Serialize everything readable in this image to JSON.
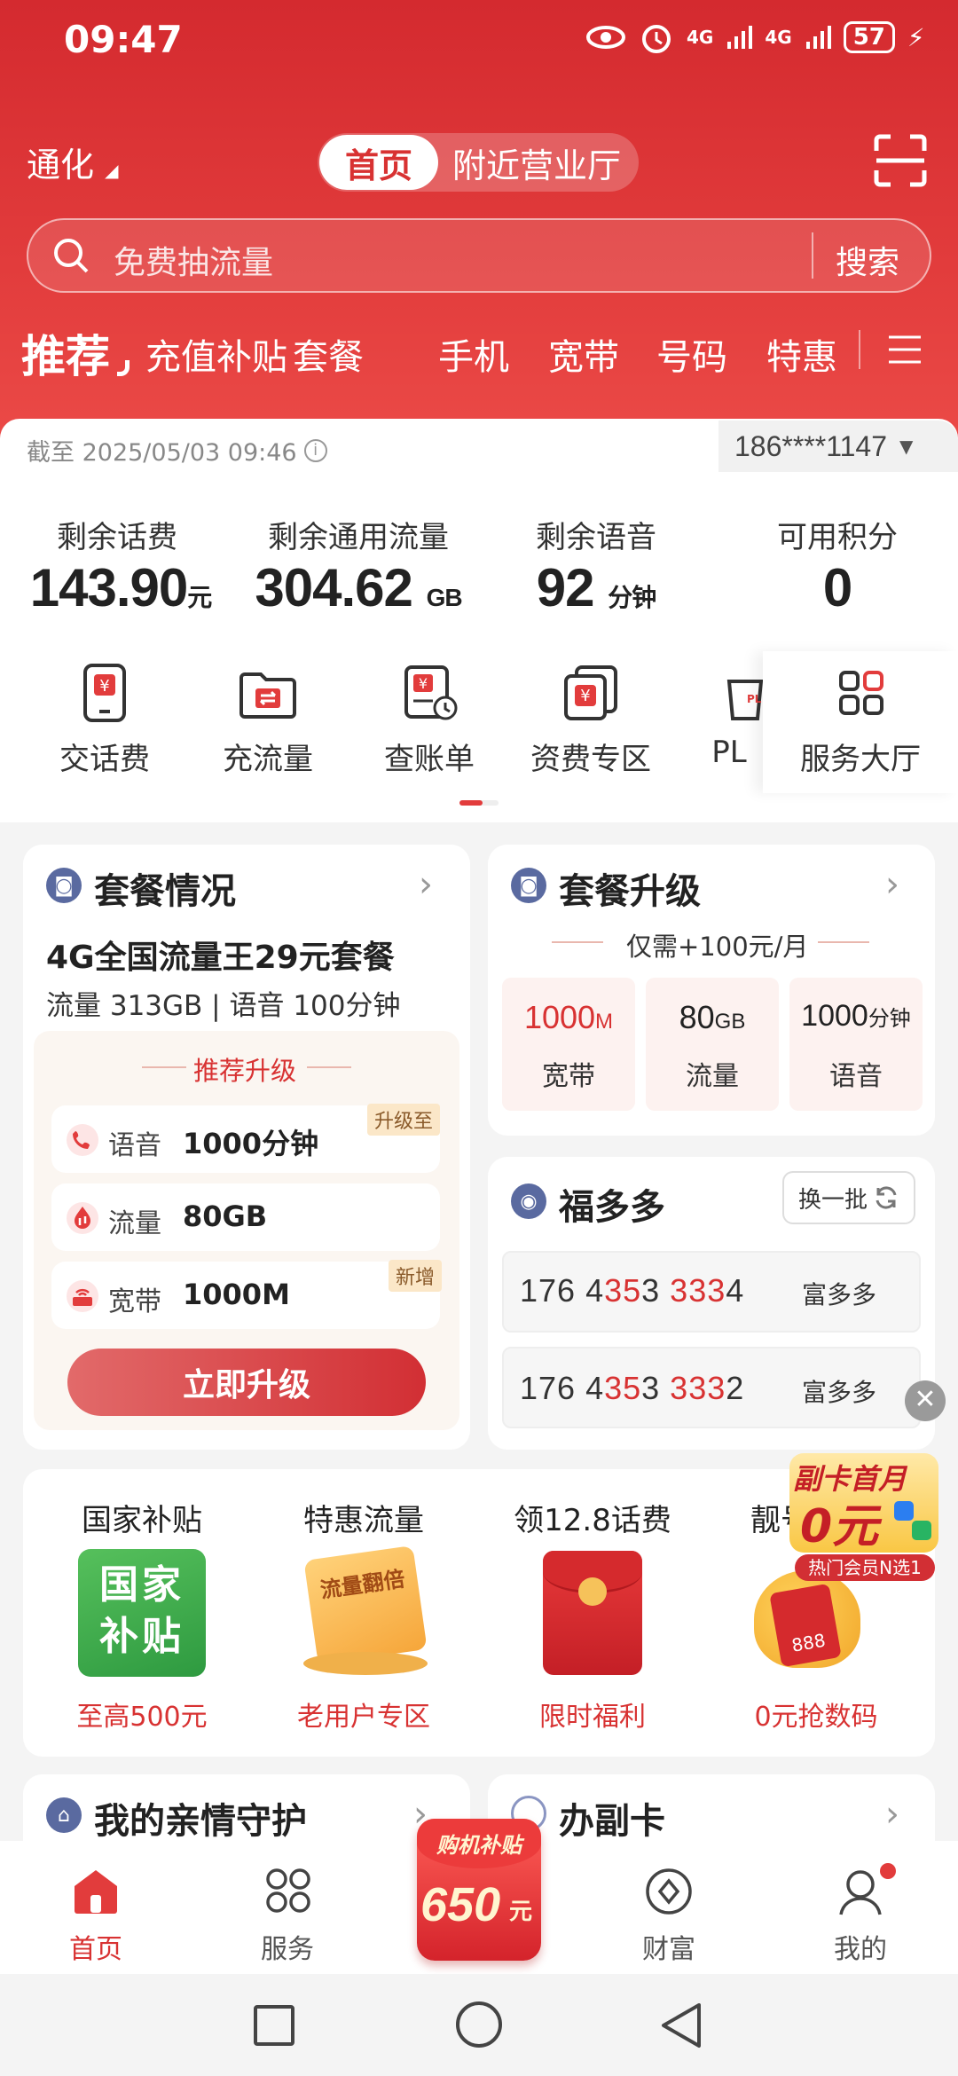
{
  "status_bar": {
    "time": "09:47",
    "battery": "57",
    "net1": "4G",
    "net2": "4G"
  },
  "header": {
    "city": "通化",
    "tabs": [
      "首页",
      "附近营业厅"
    ],
    "search": {
      "placeholder": "免费抽流量",
      "button": "搜索"
    },
    "categories": [
      "推荐",
      "充值补贴",
      "套餐",
      "手机",
      "宽带",
      "号码",
      "特惠"
    ]
  },
  "account": {
    "timestamp": "截至 2025/05/03 09:46",
    "phone": "186****1147",
    "stats": [
      {
        "label": "剩余话费",
        "value": "143.90",
        "unit": "元"
      },
      {
        "label": "剩余通用流量",
        "value": "304.62",
        "unit": "GB"
      },
      {
        "label": "剩余语音",
        "value": "92",
        "unit": "分钟"
      },
      {
        "label": "可用积分",
        "value": "0",
        "unit": ""
      }
    ],
    "services": [
      "交话费",
      "充流量",
      "查账单",
      "资费专区",
      "PL",
      "服务大厅"
    ]
  },
  "plan": {
    "title": "套餐情况",
    "name": "4G全国流量王29元套餐",
    "detail": "流量 313GB | 语音 100分钟",
    "upgrade_title": "推荐升级",
    "rows": [
      {
        "label": "语音",
        "value": "1000分钟",
        "tag": "升级至"
      },
      {
        "label": "流量",
        "value": "80GB",
        "tag": ""
      },
      {
        "label": "宽带",
        "value": "1000M",
        "tag": "新增"
      }
    ],
    "button": "立即升级"
  },
  "upgrade": {
    "title": "套餐升级",
    "subtitle": "仅需+100元/月",
    "cells": [
      {
        "value": "1000",
        "unit": "M",
        "label": "宽带"
      },
      {
        "value": "80",
        "unit": "GB",
        "label": "流量"
      },
      {
        "value": "1000",
        "unit": "分钟",
        "label": "语音"
      }
    ]
  },
  "fuduoduo": {
    "title": "福多多",
    "refresh": "换一批",
    "numbers": [
      {
        "a": "176 4",
        "b": "35",
        "c": "3 ",
        "d": "333",
        "e": "4",
        "tag": "富多多"
      },
      {
        "a": "176 4",
        "b": "35",
        "c": "3 ",
        "d": "333",
        "e": "2",
        "tag": "富多多"
      }
    ]
  },
  "promo_float": {
    "line1": "副卡首月",
    "line2": "0元",
    "line3": "热门会员N选1"
  },
  "promos": [
    {
      "title": "国家补贴",
      "sub": "至高500元",
      "pic": "国家补贴"
    },
    {
      "title": "特惠流量",
      "sub": "老用户专区",
      "pic": "流量翻倍"
    },
    {
      "title": "领12.8话费",
      "sub": "限时福利",
      "pic": ""
    },
    {
      "title": "靓号",
      "sub": "0元抢数码",
      "pic": "888"
    }
  ],
  "bottom_cards": {
    "left": "我的亲情守护",
    "right": "办副卡"
  },
  "nav": {
    "items": [
      "首页",
      "服务",
      "财富",
      "我的"
    ],
    "center_badge_top": "购机补贴",
    "center_badge_value": "650",
    "center_badge_unit": "元"
  }
}
